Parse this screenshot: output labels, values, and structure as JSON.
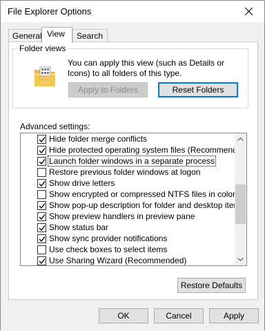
{
  "window": {
    "title": "File Explorer Options"
  },
  "tabs": [
    {
      "label": "General",
      "active": false
    },
    {
      "label": "View",
      "active": true
    },
    {
      "label": "Search",
      "active": false
    }
  ],
  "folder_views": {
    "legend": "Folder views",
    "description": "You can apply this view (such as Details or Icons) to all folders of this type.",
    "apply_button": "Apply to Folders",
    "reset_button": "Reset Folders"
  },
  "advanced": {
    "label": "Advanced settings:",
    "items": [
      {
        "label": "Hide folder merge conflicts",
        "checked": true
      },
      {
        "label": "Hide protected operating system files (Recommended)",
        "checked": true
      },
      {
        "label": "Launch folder windows in a separate process",
        "checked": true,
        "selected": true
      },
      {
        "label": "Restore previous folder windows at logon",
        "checked": false
      },
      {
        "label": "Show drive letters",
        "checked": true
      },
      {
        "label": "Show encrypted or compressed NTFS files in color",
        "checked": false
      },
      {
        "label": "Show pop-up description for folder and desktop items",
        "checked": true
      },
      {
        "label": "Show preview handlers in preview pane",
        "checked": true
      },
      {
        "label": "Show status bar",
        "checked": true
      },
      {
        "label": "Show sync provider notifications",
        "checked": true
      },
      {
        "label": "Use check boxes to select items",
        "checked": false
      },
      {
        "label": "Use Sharing Wizard (Recommended)",
        "checked": true
      }
    ],
    "restore_button": "Restore Defaults"
  },
  "footer": {
    "ok": "OK",
    "cancel": "Cancel",
    "apply": "Apply"
  },
  "icons": {
    "close": "close-icon",
    "folder": "folder-icon",
    "check": "checkmark-icon",
    "scroll_up": "chevron-up-icon",
    "scroll_down": "chevron-down-icon"
  },
  "colors": {
    "selection": "#0078d7",
    "window_bg": "#f0f0f0",
    "panel_bg": "#ffffff"
  }
}
